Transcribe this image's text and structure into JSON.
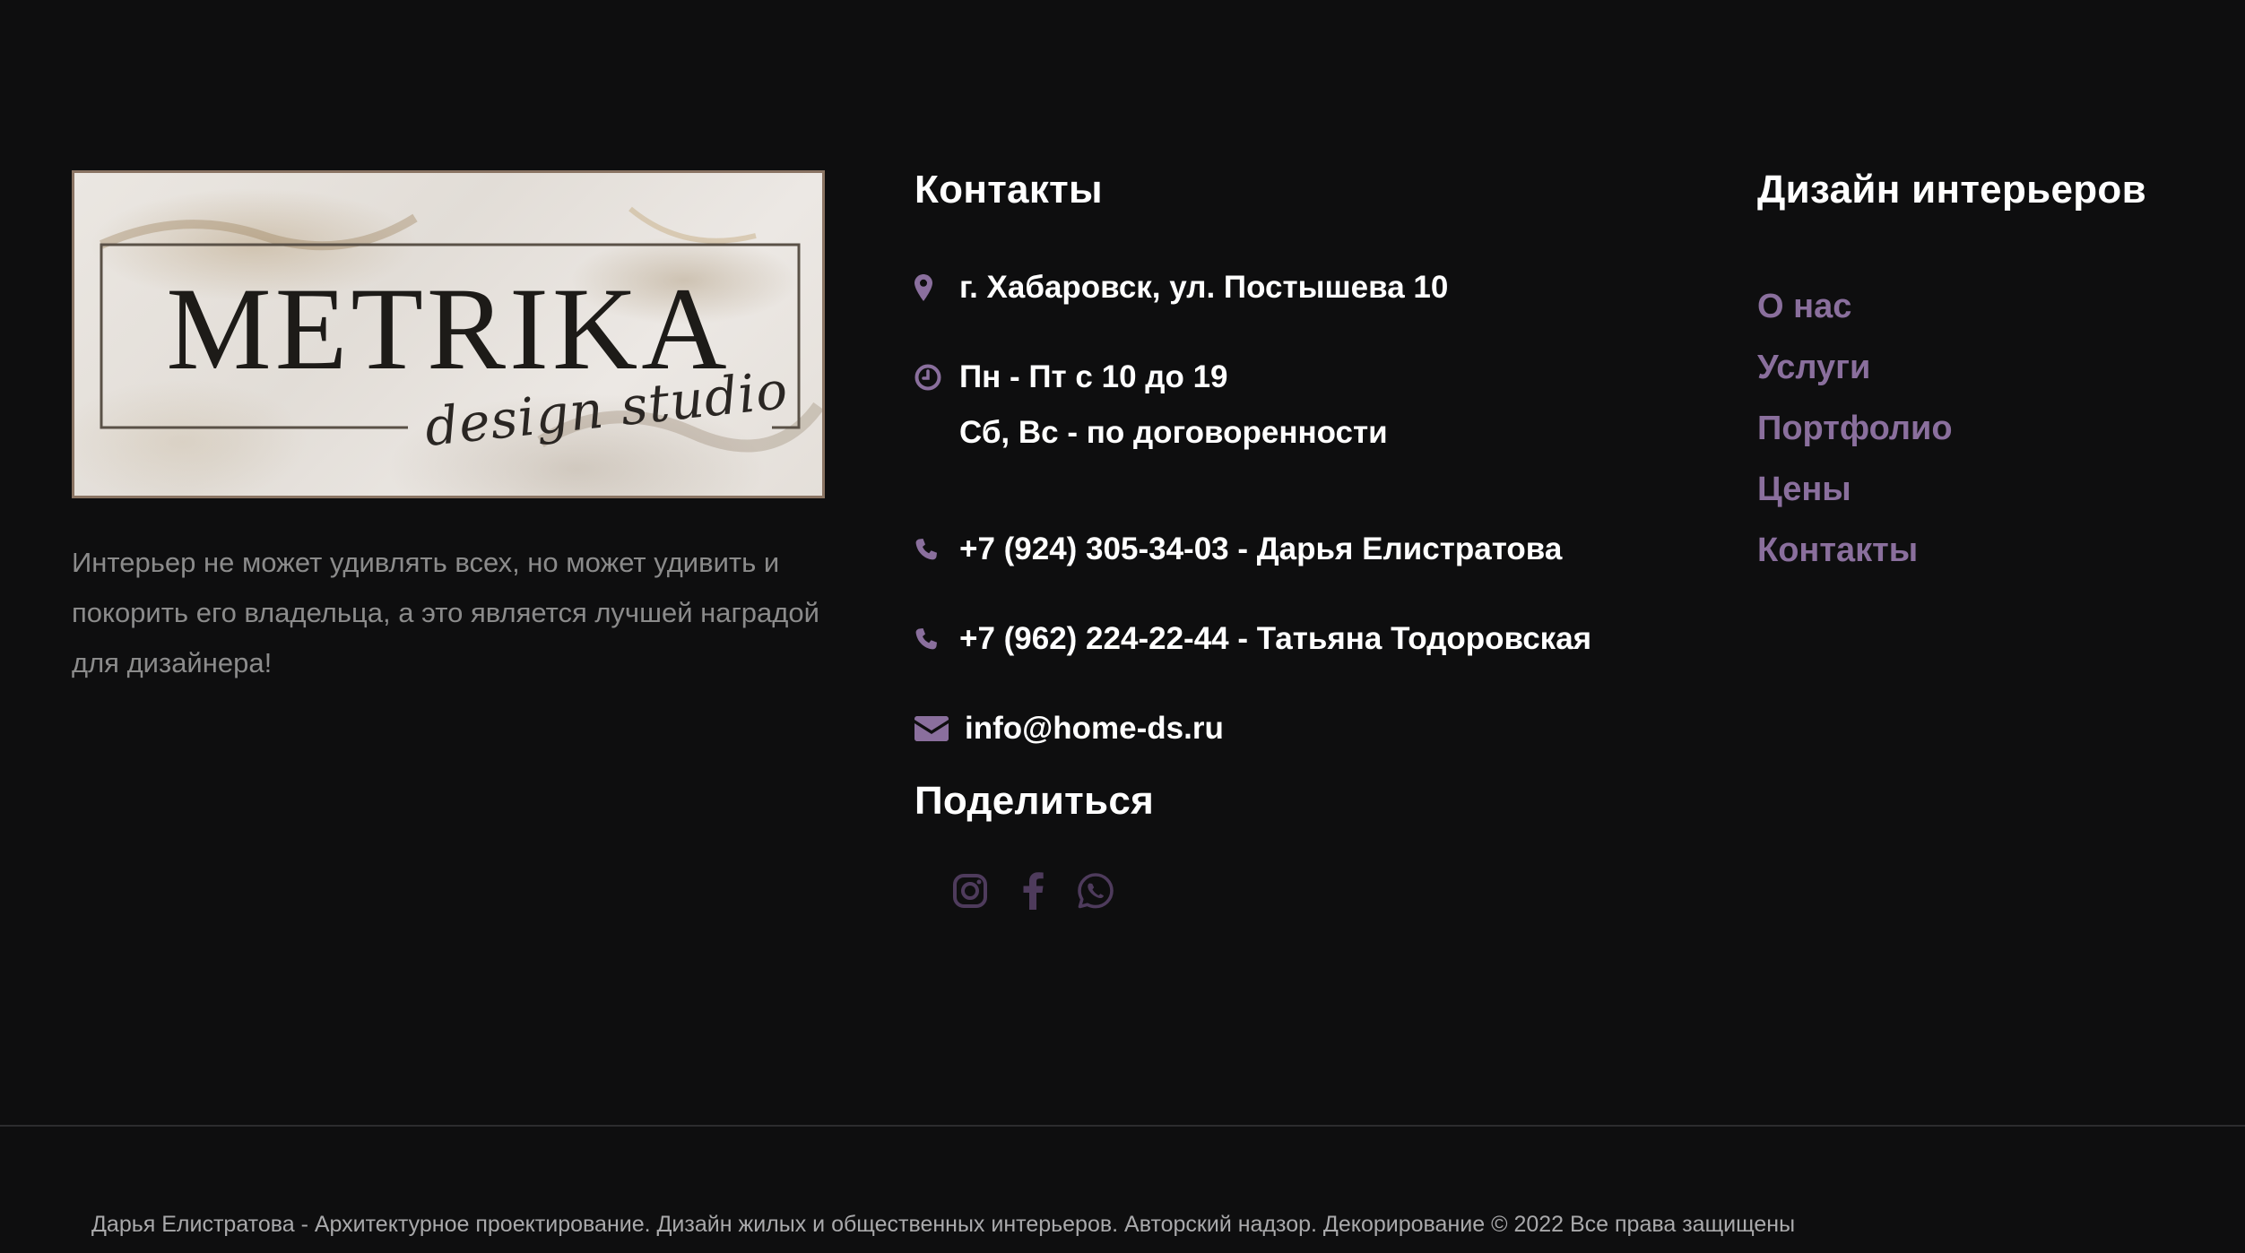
{
  "brand": {
    "logo_word": "METRIKA",
    "logo_script": "design studio"
  },
  "tagline": "Интерьер не может удивлять всех, но может удивить и покорить его владельца, а это является лучшей наградой для дизайнера!",
  "contacts": {
    "heading": "Контакты",
    "address": "г. Хабаровск, ул. Постышева 10",
    "hours_line1": "Пн - Пт с 10 до 19",
    "hours_line2": "Сб, Вс - по договоренности",
    "phone1": "+7 (924) 305-34-03 - Дарья Елистратова",
    "phone2": "+7 (962) 224-22-44 - Татьяна Тодоровская",
    "email": "info@home-ds.ru",
    "icons": {
      "address": "map-marker-icon",
      "hours": "clock-icon",
      "phone": "phone-icon",
      "email": "envelope-icon"
    }
  },
  "share": {
    "heading": "Поделиться",
    "icons": [
      "instagram-icon",
      "facebook-icon",
      "whatsapp-icon"
    ]
  },
  "menu": {
    "heading": "Дизайн интерьеров",
    "items": [
      {
        "label": "О нас"
      },
      {
        "label": "Услуги"
      },
      {
        "label": "Портфолио"
      },
      {
        "label": "Цены"
      },
      {
        "label": "Контакты"
      }
    ]
  },
  "footer": {
    "copyright": "Дарья Елистратова - Архитектурное проектирование. Дизайн жилых и общественных интерьеров. Авторский надзор. Декорирование © 2022 Все права защищены"
  },
  "colors": {
    "background": "#0e0e0f",
    "accent": "#8a6f9d",
    "social_icons": "#4e3b5c",
    "text_primary": "#ffffff",
    "text_muted": "#8b8b8b"
  }
}
